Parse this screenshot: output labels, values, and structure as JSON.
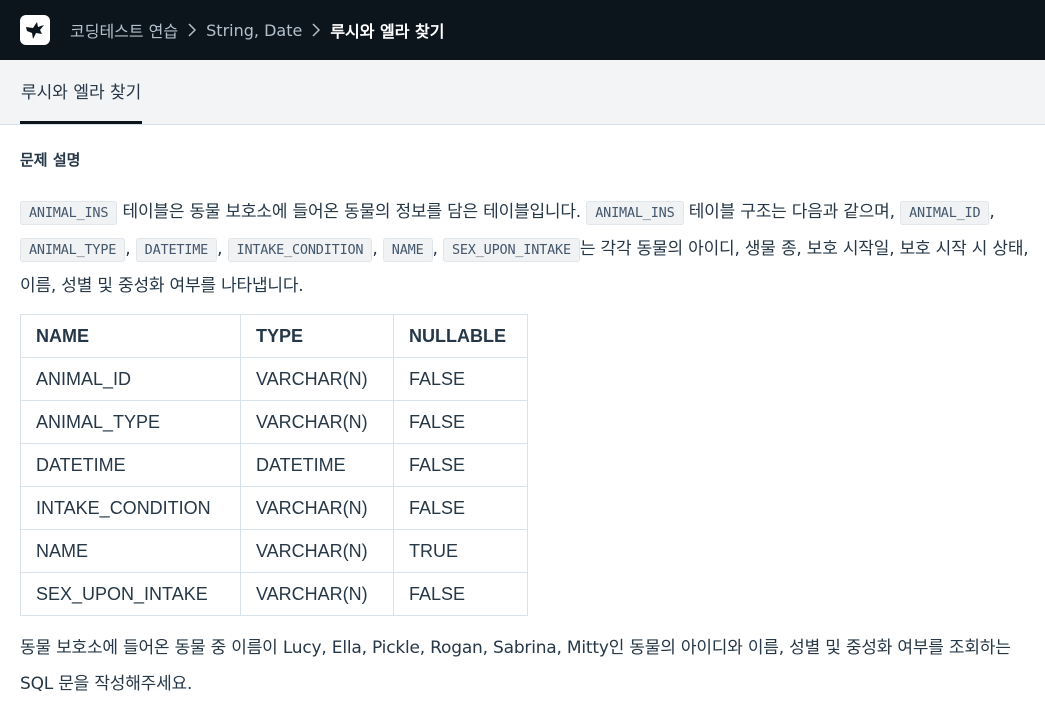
{
  "header": {
    "logo_icon": "bird-logo-icon",
    "breadcrumb": [
      "코딩테스트 연습",
      "String, Date",
      "루시와 엘라 찾기"
    ]
  },
  "tabs": [
    {
      "label": "루시와 엘라 찾기",
      "active": true
    }
  ],
  "problem": {
    "section_title": "문제 설명",
    "desc": {
      "code_animal_ins": "ANIMAL_INS",
      "text1": "테이블은 동물 보호소에 들어온 동물의 정보를 담은 테이블입니다.",
      "text2": "테이블 구조는 다음과 같으며,",
      "code_animal_id": "ANIMAL_ID",
      "code_animal_type": "ANIMAL_TYPE",
      "code_datetime": "DATETIME",
      "code_intake_condition": "INTAKE_CONDITION",
      "code_name": "NAME",
      "code_sex_upon_intake": "SEX_UPON_INTAKE",
      "comma": ",",
      "text3": "는 각각 동물의 아이디, 생물 종, 보호 시작일, 보호 시작 시 상태, 이름, 성별 및 중성화 여부를 나타냅니다."
    },
    "table": {
      "headers": [
        "NAME",
        "TYPE",
        "NULLABLE"
      ],
      "rows": [
        [
          "ANIMAL_ID",
          "VARCHAR(N)",
          "FALSE"
        ],
        [
          "ANIMAL_TYPE",
          "VARCHAR(N)",
          "FALSE"
        ],
        [
          "DATETIME",
          "DATETIME",
          "FALSE"
        ],
        [
          "INTAKE_CONDITION",
          "VARCHAR(N)",
          "FALSE"
        ],
        [
          "NAME",
          "VARCHAR(N)",
          "TRUE"
        ],
        [
          "SEX_UPON_INTAKE",
          "VARCHAR(N)",
          "FALSE"
        ]
      ]
    },
    "question": "동물 보호소에 들어온 동물 중 이름이 Lucy, Ella, Pickle, Rogan, Sabrina, Mitty인 동물의 아이디와 이름, 성별 및 중성화 여부를 조회하는 SQL 문을 작성해주세요."
  },
  "colors": {
    "topbar": "#0c151c",
    "tabbar": "#f2f4f6",
    "text": "#263747",
    "border": "#d7e2eb"
  }
}
